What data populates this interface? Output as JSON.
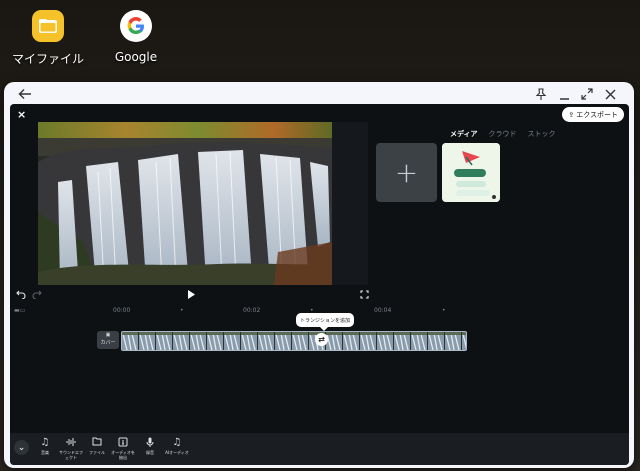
{
  "desktop": {
    "icons": [
      {
        "label": "マイファイル",
        "icon": "folder-icon"
      },
      {
        "label": "Google",
        "icon": "google-icon"
      }
    ]
  },
  "window": {
    "back_icon": "arrow-left-icon",
    "pin_icon": "pin-icon",
    "minimize_icon": "minimize-icon",
    "maximize_icon": "maximize-icon",
    "close_icon": "close-icon"
  },
  "editor": {
    "close_glyph": "×",
    "export_label": "エクスポート",
    "media_tabs": [
      "メディア",
      "クラウド",
      "ストック"
    ],
    "active_tab": 0,
    "add_media_glyph": "+",
    "timeline": {
      "ticks": [
        "00:00",
        "00:02",
        "00:04"
      ],
      "transition_tooltip": "トランジションを追加",
      "start_clip_label": "カバー"
    },
    "toolbar": [
      {
        "label": "音楽",
        "icon": "music-note-icon"
      },
      {
        "label": "サウンドエフェクト",
        "icon": "waveform-icon"
      },
      {
        "label": "ファイル",
        "icon": "folder-icon"
      },
      {
        "label": "オーディオを抽出",
        "icon": "extract-audio-icon"
      },
      {
        "label": "録音",
        "icon": "microphone-icon"
      },
      {
        "label": "AIオーディオ",
        "icon": "ai-audio-icon"
      }
    ]
  },
  "colors": {
    "editor_bg": "#0e1114",
    "window_bg": "#f4f6fb",
    "folder_yellow": "#f6c22a"
  }
}
